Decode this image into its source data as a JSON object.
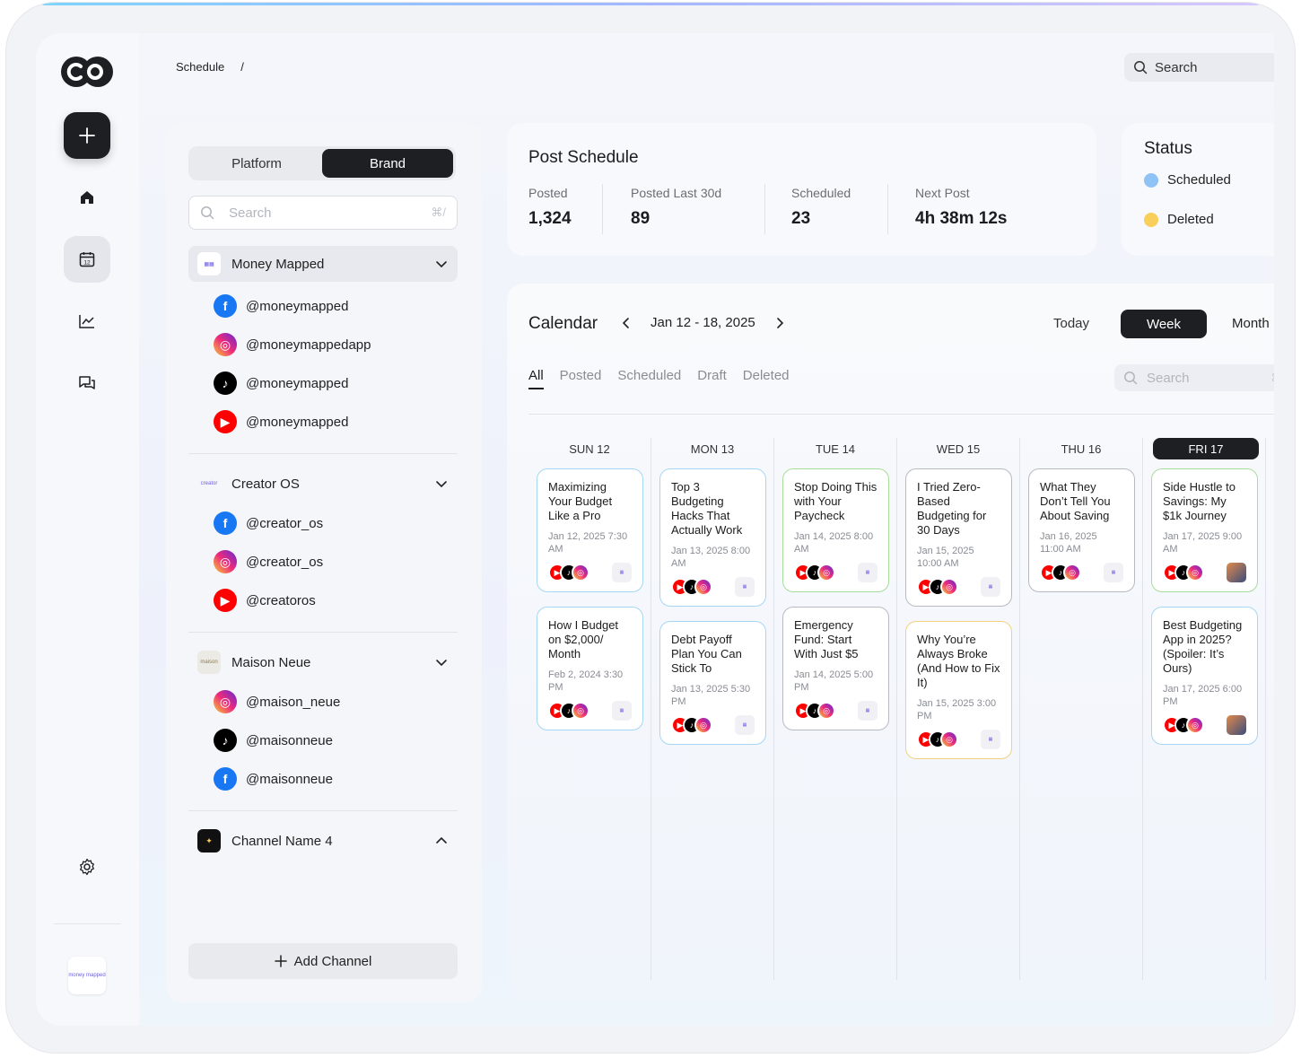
{
  "breadcrumb": {
    "current": "Schedule",
    "separator": "/"
  },
  "top_search": {
    "placeholder": "Search"
  },
  "rail": {
    "items": [
      {
        "name": "add-icon"
      },
      {
        "name": "home-icon"
      },
      {
        "name": "calendar-icon",
        "label": "12"
      },
      {
        "name": "analytics-icon"
      },
      {
        "name": "messages-icon"
      },
      {
        "name": "settings-icon"
      }
    ],
    "workspace_logo": "money mapped"
  },
  "side": {
    "toggle": {
      "platform": "Platform",
      "brand": "Brand",
      "selected": "Brand"
    },
    "search": {
      "placeholder": "Search",
      "shortcut": "⌘/"
    },
    "brands": [
      {
        "name": "Money Mapped",
        "expanded": true,
        "accounts": [
          {
            "platform": "facebook",
            "handle": "@moneymapped"
          },
          {
            "platform": "instagram",
            "handle": "@moneymappedapp"
          },
          {
            "platform": "tiktok",
            "handle": "@moneymapped"
          },
          {
            "platform": "youtube",
            "handle": "@moneymapped"
          }
        ]
      },
      {
        "name": "Creator OS",
        "expanded": true,
        "accounts": [
          {
            "platform": "facebook",
            "handle": "@creator_os"
          },
          {
            "platform": "instagram",
            "handle": "@creator_os"
          },
          {
            "platform": "youtube",
            "handle": "@creatoros"
          }
        ]
      },
      {
        "name": "Maison Neue",
        "expanded": true,
        "accounts": [
          {
            "platform": "instagram",
            "handle": "@maison_neue"
          },
          {
            "platform": "tiktok",
            "handle": "@maisonneue"
          },
          {
            "platform": "facebook",
            "handle": "@maisonneue"
          }
        ]
      },
      {
        "name": "Channel Name 4",
        "expanded": false,
        "accounts": []
      }
    ],
    "add_channel": "Add Channel"
  },
  "post_schedule": {
    "title": "Post Schedule",
    "stats": [
      {
        "label": "Posted",
        "value": "1,324"
      },
      {
        "label": "Posted Last 30d",
        "value": "89"
      },
      {
        "label": "Scheduled",
        "value": "23"
      },
      {
        "label": "Next Post",
        "value": "4h 38m 12s"
      }
    ]
  },
  "status": {
    "title": "Status",
    "items": [
      {
        "label": "Scheduled",
        "color": "#8fc2f5"
      },
      {
        "label": "Deleted",
        "color": "#f7cf5a"
      }
    ]
  },
  "calendar": {
    "title": "Calendar",
    "range": "Jan 12 - 18, 2025",
    "today": "Today",
    "week": "Week",
    "month": "Month",
    "tabs": [
      "All",
      "Posted",
      "Scheduled",
      "Draft",
      "Deleted"
    ],
    "search": {
      "placeholder": "Search",
      "shortcut": "⌘/"
    },
    "days": [
      {
        "label": "SUN 12",
        "posts": [
          {
            "title": "Maximizing Your Budget Like a Pro",
            "date": "Jan 12, 2025 7:30 AM",
            "style": "blue",
            "brand": "mm"
          },
          {
            "title": "How I Budget on $2,000/ Month",
            "date": "Feb 2, 2024 3:30 PM",
            "style": "blue",
            "brand": "mm"
          }
        ]
      },
      {
        "label": "MON 13",
        "posts": [
          {
            "title": "Top 3 Budgeting Hacks That Actually Work",
            "date": "Jan 13, 2025 8:00 AM",
            "style": "blue",
            "brand": "mm"
          },
          {
            "title": "Debt Payoff Plan You Can Stick To",
            "date": "Jan 13, 2025 5:30 PM",
            "style": "blue",
            "brand": "mm"
          }
        ]
      },
      {
        "label": "TUE 14",
        "posts": [
          {
            "title": "Stop Doing This with Your Paycheck",
            "date": "Jan 14, 2025 8:00 AM",
            "style": "green",
            "brand": "mm"
          },
          {
            "title": "Emergency Fund: Start With Just $5",
            "date": "Jan 14, 2025 5:00 PM",
            "style": "grey",
            "brand": "mm"
          }
        ]
      },
      {
        "label": "WED 15",
        "posts": [
          {
            "title": "I Tried Zero-Based Budgeting for 30 Days",
            "date": "Jan 15, 2025 10:00 AM",
            "style": "grey",
            "brand": "mm"
          },
          {
            "title": "Why You’re Always Broke (And How to Fix It)",
            "date": "Jan 15, 2025 3:00 PM",
            "style": "yellow",
            "brand": "mm"
          }
        ]
      },
      {
        "label": "THU 16",
        "posts": [
          {
            "title": "What They Don’t Tell You About Saving",
            "date": "Jan 16, 2025 11:00 AM",
            "style": "grey",
            "brand": "mm"
          }
        ]
      },
      {
        "label": "FRI 17",
        "today": true,
        "posts": [
          {
            "title": "Side Hustle to Savings: My $1k Journey",
            "date": "Jan 17, 2025 9:00 AM",
            "style": "green",
            "brand": "photo"
          },
          {
            "title": "Best Budgeting App in 2025? (Spoiler: It’s Ours)",
            "date": "Jan 17, 2025 6:00 PM",
            "style": "blue",
            "brand": "photo"
          }
        ]
      }
    ]
  }
}
